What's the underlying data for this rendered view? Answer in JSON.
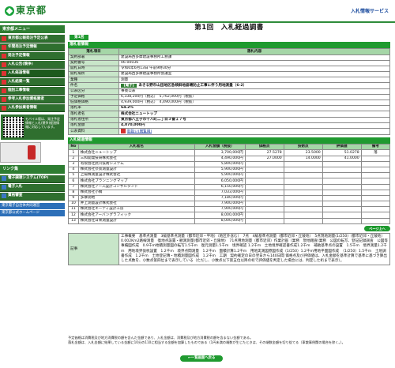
{
  "header": {
    "logo_text": "東京都",
    "service_label": "入札情報サービス"
  },
  "sidebar": {
    "caption": "東京都メニュー",
    "items": [
      {
        "label": "東京都公報発注予定公表",
        "icon": "red"
      },
      {
        "label": "年間発注予定情報",
        "icon": "red"
      },
      {
        "label": "発注予定情報",
        "icon": "red"
      },
      {
        "label": "入札公告(競争)",
        "icon": "red"
      },
      {
        "label": "入札経過情報",
        "icon": "red"
      },
      {
        "label": "入札結果一覧",
        "icon": "red"
      },
      {
        "label": "個別工事情報",
        "icon": "red"
      },
      {
        "label": "参考入札参加資格業者",
        "icon": "red"
      },
      {
        "label": "入札参加業者情報",
        "icon": "red"
      }
    ],
    "qr_text": "モバイル版は、発注予定情報と入札(競争)経過情報に対応しています。",
    "caption2": "リンク集",
    "links2": [
      {
        "label": "電子調達システム(TOP)",
        "icon": "blue"
      },
      {
        "label": "電子入札",
        "icon": "blue"
      },
      {
        "label": "資格審査",
        "icon": "blue"
      }
    ],
    "bottom_links": [
      "東京電子自治体共同運営",
      "東京都公式ホームページ"
    ]
  },
  "main": {
    "title": "第1回　入札経過調書",
    "tab_label": "第1回",
    "info_section_header": "落札者情報",
    "info_head": {
      "k": "落札項目",
      "v": "落札内容"
    },
    "info_rows": [
      {
        "k": "契約部署",
        "v": "建設局西多摩建設事務所工務課"
      },
      {
        "k": "契約番号",
        "v": "06-00036"
      },
      {
        "k": "開札日時",
        "v": "令和6年6月13日 午前9時30分"
      },
      {
        "k": "開札場所",
        "v": "建設局西多摩建設事務所会議室"
      },
      {
        "k": "業種",
        "v": "測量"
      },
      {
        "k": "件名",
        "v_badge": "【電子】",
        "v": "あきる野市山田地区急傾斜地崩壊防止工事に伴う用地測量（6-2）",
        "bold": true
      },
      {
        "k": "公表区分",
        "v": "事後公表"
      },
      {
        "k": "予定価格",
        "v": "6,338,200円（税込）　5,762,000円（税抜）"
      },
      {
        "k": "低価格価格",
        "v": "4,939,000円（税込）　4,490,000円（税抜）"
      },
      {
        "k": "落札率",
        "v": "64.2%",
        "bold": true
      },
      {
        "k": "落札者名",
        "v": "株式会社ニュートップ",
        "bold": true
      },
      {
        "k": "落札者住所",
        "v": "東京都八王子市千人町二丁目３番１７号",
        "bold": true
      },
      {
        "k": "落札金額",
        "v": "4,070,000円",
        "bold": true
      },
      {
        "k": "公表資料",
        "v": "取扱い(閲覧用)",
        "pdf": true
      }
    ],
    "bid_section_header": "入札経過情報",
    "bid_headers": [
      "No",
      "入札者名",
      "入札金額（税抜）",
      "価格点",
      "技術点",
      "評価値",
      "備考"
    ],
    "bids": [
      {
        "no": "1",
        "name": "株式会社ニュートップ",
        "amount": "3,700,000円",
        "price": "27.5278",
        "tech": "23.5000",
        "eval": "51.0278",
        "note": "落"
      },
      {
        "no": "2",
        "name": "三和開発技研株式会社",
        "amount": "4,490,000円",
        "price": "27.0000",
        "tech": "14.0000",
        "eval": "41.0000",
        "note": ""
      },
      {
        "no": "3",
        "name": "有限会社武川技術システム",
        "amount": "5,800,000円",
        "price": "",
        "tech": "",
        "eval": "",
        "note": ""
      },
      {
        "no": "4",
        "name": "株式会社奈景測量設計",
        "amount": "5,900,000円",
        "price": "",
        "tech": "",
        "eval": "",
        "note": ""
      },
      {
        "no": "5",
        "name": "上陽株測量設計株式会社",
        "amount": "5,900,000円",
        "price": "",
        "tech": "",
        "eval": "",
        "note": ""
      },
      {
        "no": "6",
        "name": "株式会社プランニングマップ",
        "amount": "6,050,000円",
        "price": "",
        "tech": "",
        "eval": "",
        "note": ""
      },
      {
        "no": "7",
        "name": "株式会社アース設計コンサルタント",
        "amount": "6,150,000円",
        "price": "",
        "tech": "",
        "eval": "",
        "note": ""
      },
      {
        "no": "8",
        "name": "株式会社小橋",
        "amount": "7,033,000円",
        "price": "",
        "tech": "",
        "eval": "",
        "note": ""
      },
      {
        "no": "9",
        "name": "多摩測地",
        "amount": "7,180,000円",
        "price": "",
        "tech": "",
        "eval": "",
        "note": ""
      },
      {
        "no": "10",
        "name": "井上測量設計株式会社",
        "amount": "7,900,000円",
        "price": "",
        "tech": "",
        "eval": "",
        "note": ""
      },
      {
        "no": "11",
        "name": "株式会社エーディ設計工房",
        "amount": "7,900,000円",
        "price": "",
        "tech": "",
        "eval": "",
        "note": ""
      },
      {
        "no": "12",
        "name": "株式会社アーバングラフィック",
        "amount": "8,000,000円",
        "price": "",
        "tech": "",
        "eval": "",
        "note": ""
      },
      {
        "no": "13",
        "name": "株式会社日栄測量設計",
        "amount": "8,000,000円",
        "price": "",
        "tech": "",
        "eval": "",
        "note": ""
      }
    ],
    "more_button": "ページ上へ",
    "notes_label": "記事",
    "notes_text": "工事概要　基準点測量　3級基準点測量（都市近郊・平地）（地区外含む）　7点　4級基準点測量（都市近郊・丘陵地）　5点現地測量(1/250)（都市近郊・丘陵地）　0.002Km2路線測量　復地点設置・観測測量(都市近郊・丘陵地)　71点用地測量（都市近郊）作業計画（業務　現地踏査(業務　公図の転写、登記記録調査　公図等事績図作成　0.9千m地積測量図の転写1.5千m　復元測量1.5千m　境界確認 1.2千m　土地境界確認書作成1.2千m　補助基準点の設置　1.5千m　境界測量1.2千m　用地境界仮杭設置　1.2千m　境界点間測量　1.2千m　面積計算1.2千m　用地実測図原図作成（1/250）1.2千m用地平面図作成　（1/250）1.5千m　土地調書作成　1.2千m　土地登記簿・地積測量図作成　1.2千m　工期　契約確定の日の翌日から140日間\n価格点及び評価値は、入札金額を基準計算で基準に基づき算出した点数を、小数点第四位まで表示している（ただし、小数点以下第五位以降の桁で評価値を判定した場合には、判定した桁まで表示）。"
  },
  "footer": {
    "line1": "予定価格は消費税及び地方消費税の額を含んだ金額であり、入札金額は、消費税及び地方消費税の額を含まない金額である。",
    "line2": "落札金額は、入札金額に結果している金額に10分の110に相当する金額を加算したものである（1円未満の端数が生じたときは、その端数金額を切り捨てる（車散事例関の場合を除く。）。",
    "back_button": "←一覧画面へ戻る"
  }
}
